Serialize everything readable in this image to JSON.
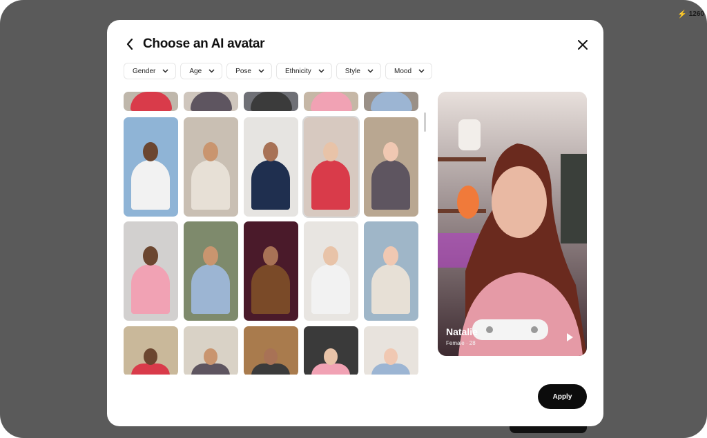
{
  "status_badge": {
    "value": "1260"
  },
  "modal": {
    "title": "Choose an AI avatar",
    "back_icon": "chevron-left-icon",
    "close_icon": "close-icon"
  },
  "filters": [
    {
      "label": "Gender"
    },
    {
      "label": "Age"
    },
    {
      "label": "Pose"
    },
    {
      "label": "Ethnicity"
    },
    {
      "label": "Style"
    },
    {
      "label": "Mood"
    }
  ],
  "avatar_grid": {
    "selected_index": 8,
    "colors": {
      "row0": [
        "#bfb7ab",
        "#cfc6bd",
        "#6f7076",
        "#c6b7a6",
        "#9a9087"
      ],
      "row1": [
        "#8fb4d6",
        "#c9bfb3",
        "#e6e4e1",
        "#d7c9c0",
        "#b9a791"
      ],
      "row2": [
        "#d2d0cf",
        "#7e8a6c",
        "#4a1a2a",
        "#e8e5e1",
        "#9fb6c8"
      ],
      "row3": [
        "#c9b89a",
        "#d9d2c6",
        "#a97b4d",
        "#3a3a3a",
        "#e8e3dd"
      ]
    }
  },
  "preview": {
    "name": "Natalie",
    "meta": "Female · 28",
    "play_icon": "play-icon"
  },
  "apply_button": {
    "label": "Apply"
  }
}
